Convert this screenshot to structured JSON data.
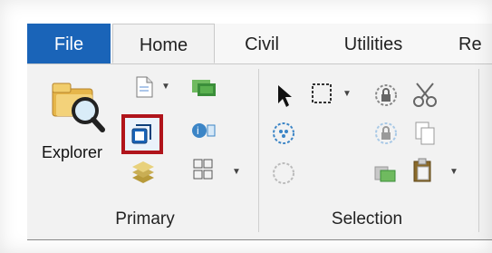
{
  "tabs": {
    "file": "File",
    "home": "Home",
    "civil": "Civil",
    "utilities": "Utilities",
    "partial": "Re"
  },
  "groups": {
    "primary": "Primary",
    "selection": "Selection"
  },
  "buttons": {
    "explorer": "Explorer"
  },
  "colors": {
    "file_tab": "#1a64b8",
    "highlight_box": "#b0141b",
    "selected_icon": "#1a64b8"
  },
  "icons": [
    "explorer-icon",
    "new-file-icon",
    "id-card-icon",
    "3d-box-icon",
    "info-card-icon",
    "layers-icon",
    "grid-icon",
    "arrow-cursor-icon",
    "rect-select-icon",
    "lock-select-icon",
    "cut-icon",
    "dotted-circle-icon",
    "lock-icon",
    "copy-icon",
    "empty-circle-icon",
    "paste-special-icon",
    "clipboard-icon"
  ]
}
